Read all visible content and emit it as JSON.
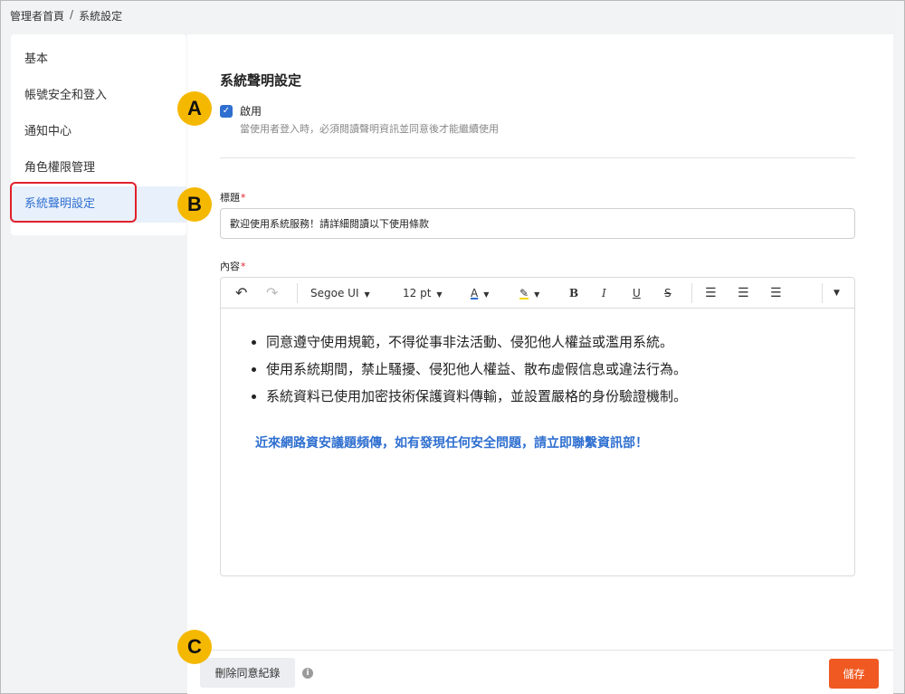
{
  "breadcrumb": {
    "home": "管理者首頁",
    "separator": "/",
    "current": "系統設定"
  },
  "sidebar": {
    "items": [
      {
        "label": "基本"
      },
      {
        "label": "帳號安全和登入"
      },
      {
        "label": "通知中心"
      },
      {
        "label": "角色權限管理"
      },
      {
        "label": "系統聲明設定",
        "active": true
      }
    ]
  },
  "main": {
    "section_title": "系統聲明設定",
    "enable": {
      "checked": true,
      "label": "啟用",
      "hint": "當使用者登入時，必須閱讀聲明資訊並同意後才能繼續使用"
    },
    "title_field": {
      "label": "標題",
      "required_mark": "*",
      "value": "歡迎使用系統服務！請詳細閱讀以下使用條款"
    },
    "content_field": {
      "label": "內容",
      "required_mark": "*"
    },
    "toolbar": {
      "undo_icon": "↶",
      "redo_icon": "↷",
      "font": "Segoe UI",
      "size": "12 pt",
      "caret": "▼",
      "font_color_icon": "A",
      "highlight_icon": "✎",
      "bold": "B",
      "italic": "I",
      "underline": "U",
      "strike": "S",
      "more_icon": "▼"
    },
    "content": {
      "bullets": [
        "同意遵守使用規範，不得從事非法活動、侵犯他人權益或濫用系統。",
        "使用系統期間，禁止騷擾、侵犯他人權益、散布虛假信息或違法行為。",
        "系統資料已使用加密技術保護資料傳輸，並設置嚴格的身份驗證機制。"
      ],
      "notice": "近來網路資安議題頻傳，如有發現任何安全問題，請立即聯繫資訊部！"
    }
  },
  "footer": {
    "delete_label": "刪除同意紀錄",
    "info_icon": "i",
    "save_label": "儲存"
  },
  "markers": {
    "a": "A",
    "b": "B",
    "c": "C"
  },
  "colors": {
    "accent": "#2f6fd0",
    "save": "#f05a22",
    "marker": "#f5b800",
    "highlight_border": "#e0212b"
  }
}
